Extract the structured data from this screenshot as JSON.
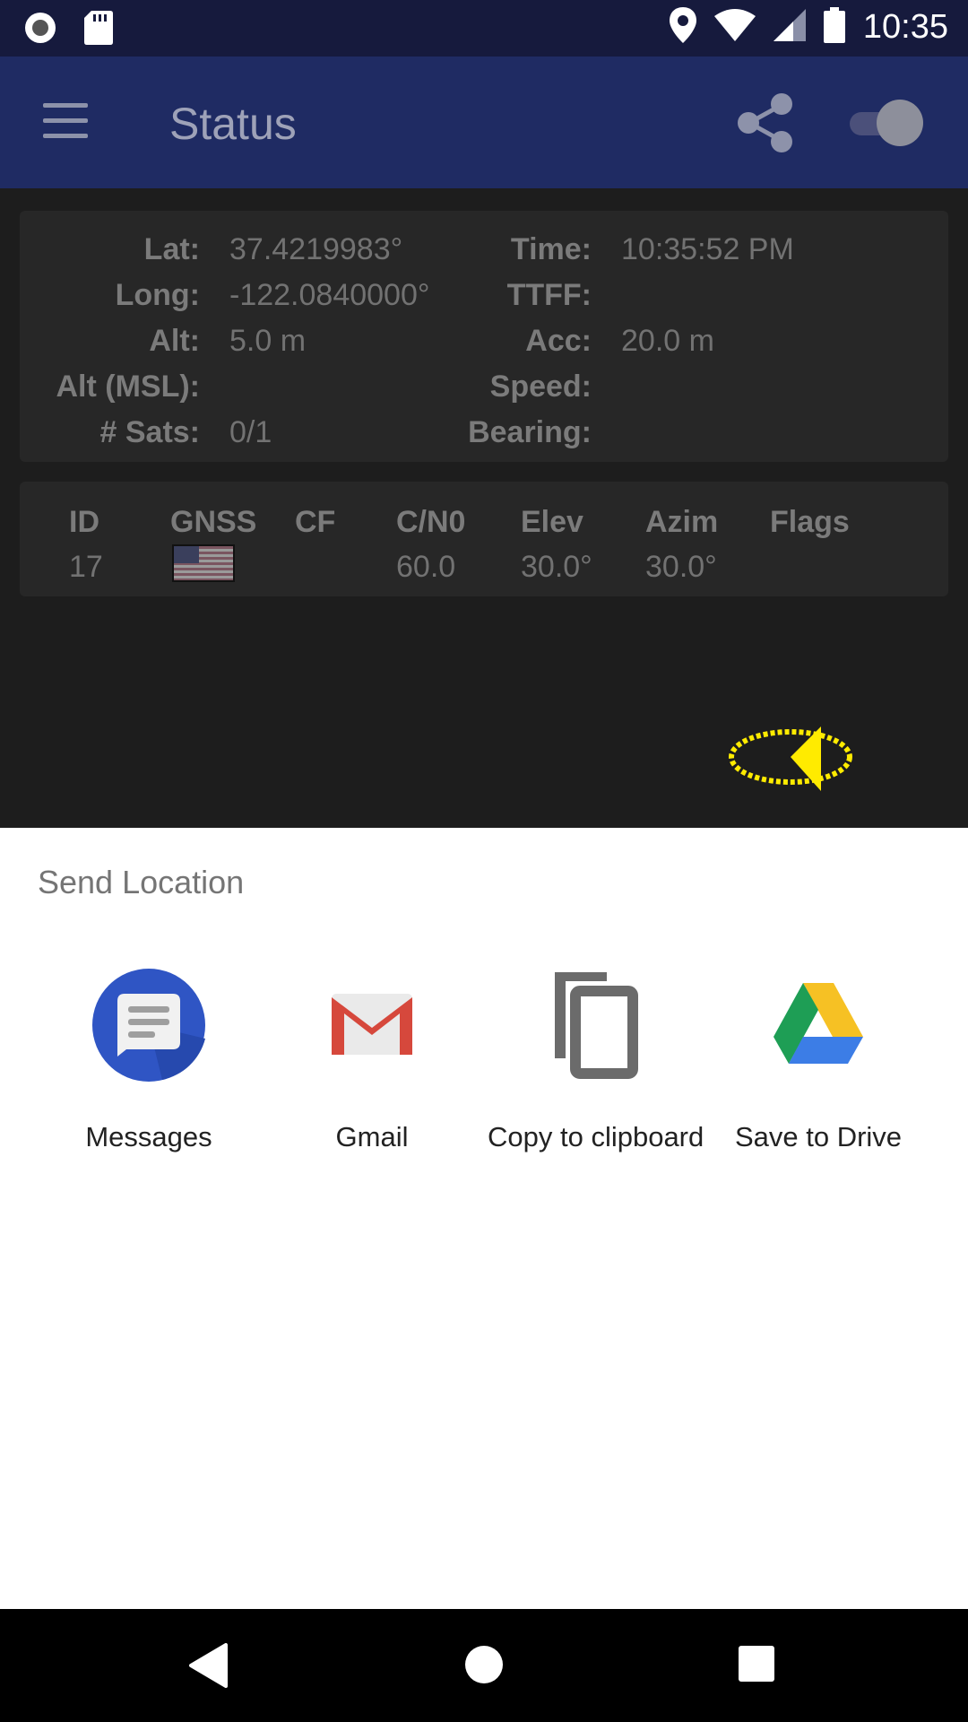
{
  "status_bar": {
    "time": "10:35",
    "icons": [
      "record-icon",
      "sd-card-icon",
      "location-icon",
      "wifi-icon",
      "cell-signal-icon",
      "battery-icon"
    ]
  },
  "app_bar": {
    "title": "Status",
    "icons": [
      "menu-icon",
      "share-icon",
      "toggle-switch"
    ]
  },
  "location_card": {
    "lat_label": "Lat:",
    "lat_value": "37.4219983°",
    "long_label": "Long:",
    "long_value": "-122.0840000°",
    "alt_label": "Alt:",
    "alt_value": "5.0 m",
    "alt_msl_label": "Alt (MSL):",
    "alt_msl_value": "",
    "sats_label": "# Sats:",
    "sats_value": "0/1",
    "time_label": "Time:",
    "time_value": "10:35:52 PM",
    "ttff_label": "TTFF:",
    "ttff_value": "",
    "acc_label": "Acc:",
    "acc_value": "20.0 m",
    "speed_label": "Speed:",
    "speed_value": "",
    "bearing_label": "Bearing:",
    "bearing_value": ""
  },
  "sat_table": {
    "headers": [
      "ID",
      "GNSS",
      "CF",
      "C/N0",
      "Elev",
      "Azim",
      "Flags"
    ],
    "rows": [
      {
        "id": "17",
        "gnss": "us-flag-icon",
        "cf": "",
        "cn0": "60.0",
        "elev": "30.0°",
        "azim": "30.0°",
        "flags": ""
      }
    ]
  },
  "share_sheet": {
    "title": "Send Location",
    "targets": [
      {
        "label": "Messages",
        "icon": "messages-icon"
      },
      {
        "label": "Gmail",
        "icon": "gmail-icon"
      },
      {
        "label": "Copy to clipboard",
        "icon": "clipboard-icon"
      },
      {
        "label": "Save to Drive",
        "icon": "drive-icon"
      }
    ]
  },
  "nav_bar": {
    "icons": [
      "back-icon",
      "home-icon",
      "recents-icon"
    ]
  },
  "colors": {
    "status_bar": "#161a3d",
    "app_bar": "#1f2b63",
    "messages_blue": "#2f55c4",
    "gmail_red": "#d6483c",
    "drive_green": "#1e9e55",
    "drive_yellow": "#f6c124",
    "drive_blue": "#3c7de6",
    "cursor_yellow": "#ffeb00"
  }
}
